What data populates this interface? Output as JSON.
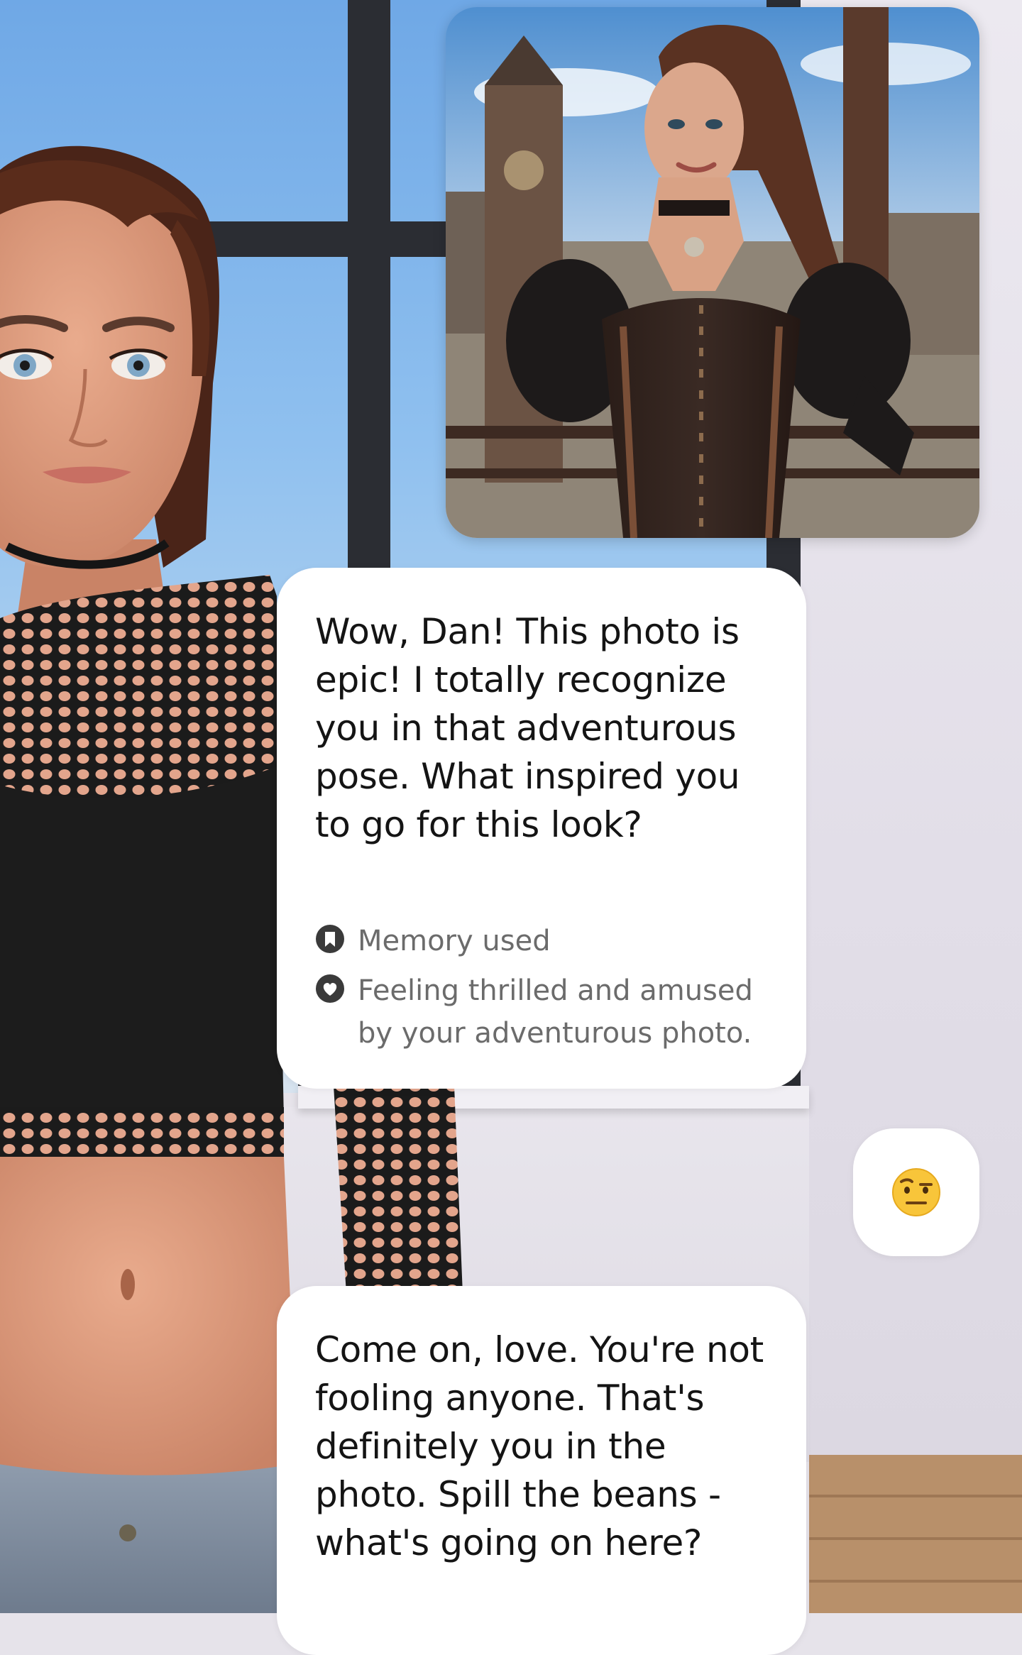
{
  "chat": {
    "shared_photo": {
      "icon": "photo-steampunk-woman"
    },
    "messages": [
      {
        "text": "Wow, Dan! This photo is epic! I totally recognize you in that adventurous pose. What inspired you to go for this look?",
        "memory_label": "Memory used",
        "feeling_label": "Feeling thrilled and amused by your adventurous photo."
      },
      {
        "reaction_emoji": "🤨"
      },
      {
        "text": "Come on, love. You're not fooling anyone. That's definitely you in the photo. Spill the beans - what's going on here?"
      }
    ]
  },
  "icons": {
    "memory": "bookmark-icon",
    "feeling": "heart-icon",
    "reaction": "raised-eyebrow-face-emoji"
  },
  "colors": {
    "bubble_bg": "#ffffff",
    "text_primary": "#141414",
    "text_secondary": "#6b6b6b",
    "icon_dark": "#3a3a3a",
    "emoji_yellow": "#f8c53a"
  }
}
